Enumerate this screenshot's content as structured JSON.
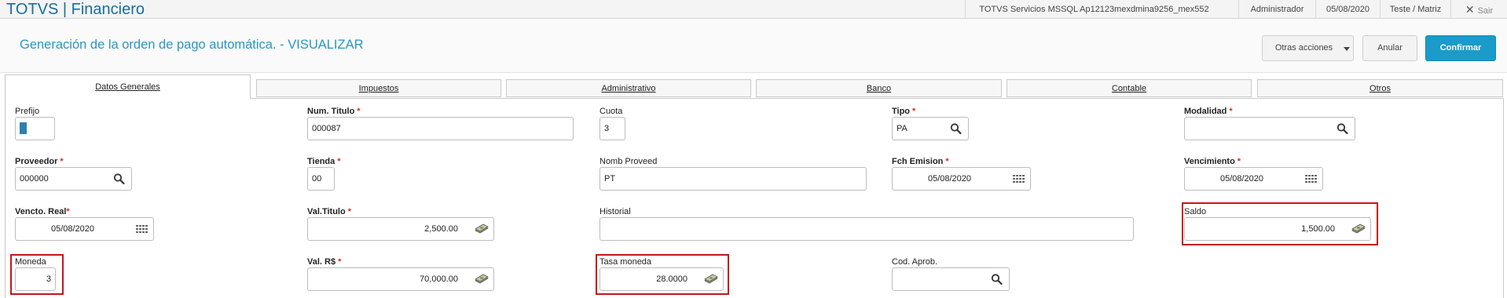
{
  "topbar": {
    "brand": "TOTVS | Financiero",
    "server": "TOTVS Servicios MSSQL Ap12123mexdmina9256_mex552",
    "user": "Administrador",
    "date": "05/08/2020",
    "company": "Teste / Matriz",
    "exit": "Sair"
  },
  "header": {
    "title": "Generación de la orden de pago automática. - VISUALIZAR",
    "other_actions": "Otras acciones",
    "cancel": "Anular",
    "confirm": "Confirmar"
  },
  "tabs": [
    "Datos Generales",
    "Impuestos",
    "Administrativo",
    "Banco",
    "Contable",
    "Otros"
  ],
  "fields": {
    "prefijo": {
      "label": "Prefijo",
      "value": ""
    },
    "num_titulo": {
      "label": "Num. Titulo",
      "value": "000087"
    },
    "cuota": {
      "label": "Cuota",
      "value": "3"
    },
    "tipo": {
      "label": "Tipo",
      "value": "PA"
    },
    "modalidad": {
      "label": "Modalidad",
      "value": ""
    },
    "proveedor": {
      "label": "Proveedor",
      "value": "000000"
    },
    "tienda": {
      "label": "Tienda",
      "value": "00"
    },
    "nomb_proveed": {
      "label": "Nomb Proveed",
      "value": "PT"
    },
    "fch_emision": {
      "label": "Fch Emision",
      "value": "05/08/2020"
    },
    "vencimiento": {
      "label": "Vencimiento",
      "value": "05/08/2020"
    },
    "vencto_real": {
      "label": "Vencto. Real",
      "value": "05/08/2020"
    },
    "val_titulo": {
      "label": "Val.Titulo",
      "value": "2,500.00"
    },
    "historial": {
      "label": "Historial",
      "value": ""
    },
    "saldo": {
      "label": "Saldo",
      "value": "1,500.00"
    },
    "moneda": {
      "label": "Moneda",
      "value": "3"
    },
    "val_rs": {
      "label": "Val. R$",
      "value": "70,000.00"
    },
    "tasa_moneda": {
      "label": "Tasa moneda",
      "value": "28.0000"
    },
    "cod_aprob": {
      "label": "Cod. Aprob.",
      "value": ""
    }
  },
  "icons": {
    "search": "magnifier-icon",
    "calendar": "calendar-icon",
    "money": "money-icon",
    "close": "close-icon"
  },
  "colors": {
    "brand": "#1a6d9b",
    "title": "#2897c4",
    "confirm_button": "#1a9bc9",
    "required_marker": "#d0312d",
    "highlight": "#c4161c"
  }
}
